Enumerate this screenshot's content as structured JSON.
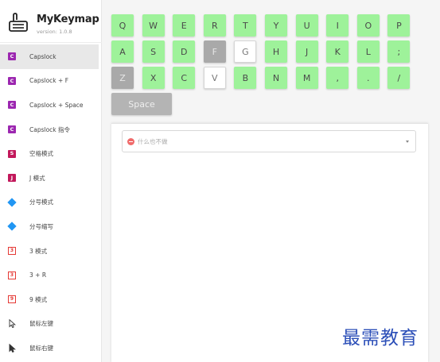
{
  "app": {
    "title": "MyKeymap",
    "version": "version: 1.0.8"
  },
  "sidebar": {
    "items": [
      {
        "label": "Capslock",
        "badge": "C",
        "icon": "capslock-icon"
      },
      {
        "label": "Capslock + F",
        "badge": "C",
        "icon": "capslock-icon"
      },
      {
        "label": "Capslock + Space",
        "badge": "C",
        "icon": "capslock-icon"
      },
      {
        "label": "Capslock 指令",
        "badge": "C",
        "icon": "capslock-icon"
      },
      {
        "label": "空格模式",
        "badge": "S",
        "icon": "space-icon"
      },
      {
        "label": "J 模式",
        "badge": "J",
        "icon": "j-icon"
      },
      {
        "label": "分号模式",
        "badge": "",
        "icon": "diamond-icon"
      },
      {
        "label": "分号缩写",
        "badge": "",
        "icon": "diamond-icon"
      },
      {
        "label": "3 模式",
        "badge": "3",
        "icon": "three-icon"
      },
      {
        "label": "3 + R",
        "badge": "3",
        "icon": "three-icon"
      },
      {
        "label": "9 模式",
        "badge": "9",
        "icon": "nine-icon"
      },
      {
        "label": "鼠标左键",
        "badge": "",
        "icon": "mouse-pointer-icon"
      },
      {
        "label": "鼠标右键",
        "badge": "",
        "icon": "mouse-pointer-filled-icon"
      }
    ]
  },
  "keyboard": {
    "rows": [
      [
        "Q",
        "W",
        "E",
        "R",
        "T",
        "Y",
        "U",
        "I",
        "O",
        "P"
      ],
      [
        "A",
        "S",
        "D",
        "F",
        "G",
        "H",
        "J",
        "K",
        "L",
        ";"
      ],
      [
        "Z",
        "X",
        "C",
        "V",
        "B",
        "N",
        "M",
        ",",
        ".",
        "/"
      ]
    ],
    "space_label": "Space"
  },
  "action_select": {
    "value": "什么也不做"
  },
  "watermark": "最需教育",
  "colors": {
    "key_assigned": "#9ef29a",
    "key_current": "#a9a9a9",
    "key_unassigned": "#ffffff",
    "accent_purple": "#9c27b0",
    "accent_blue": "#2196f3",
    "watermark": "#2c4fb8"
  }
}
